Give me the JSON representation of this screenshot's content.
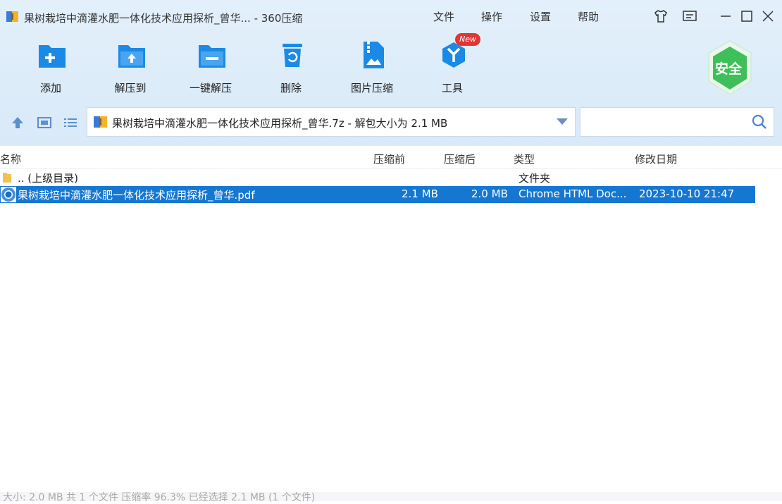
{
  "window": {
    "title": "果树栽培中滴灌水肥一体化技术应用探析_曾华... - 360压缩",
    "menus": [
      "文件",
      "操作",
      "设置",
      "帮助"
    ]
  },
  "toolbar": {
    "buttons": [
      {
        "label": "添加",
        "icon": "add-icon"
      },
      {
        "label": "解压到",
        "icon": "extract-to-icon"
      },
      {
        "label": "一键解压",
        "icon": "one-click-extract-icon"
      },
      {
        "label": "删除",
        "icon": "delete-icon"
      },
      {
        "label": "图片压缩",
        "icon": "image-compress-icon"
      },
      {
        "label": "工具",
        "icon": "tools-icon"
      }
    ],
    "new_badge": "New",
    "safe_badge": "安全"
  },
  "address": {
    "path": "果树栽培中滴灌水肥一体化技术应用探析_曾华.7z - 解包大小为 2.1 MB"
  },
  "search": {
    "value": "",
    "placeholder": ""
  },
  "table": {
    "columns": [
      "名称",
      "压缩前",
      "压缩后",
      "类型",
      "修改日期"
    ],
    "rows": [
      {
        "name": ".. (上级目录)",
        "before": "",
        "after": "",
        "type": "文件夹",
        "date": ""
      },
      {
        "name": "果树栽培中滴灌水肥一体化技术应用探析_曾华.pdf",
        "before": "2.1 MB",
        "after": "2.0 MB",
        "type": "Chrome HTML Doc...",
        "date": "2023-10-10 21:47"
      }
    ]
  },
  "status": {
    "text": "大小: 2.0 MB 共 1 个文件 压缩率 96.3% 已经选择 2.1 MB (1 个文件)"
  },
  "colors": {
    "accent": "#1677d2",
    "toolbar_bg": "#e3f0fb",
    "icon_blue": "#1a8ae6",
    "safe_green": "#3fbf5a",
    "new_red": "#e23535"
  }
}
